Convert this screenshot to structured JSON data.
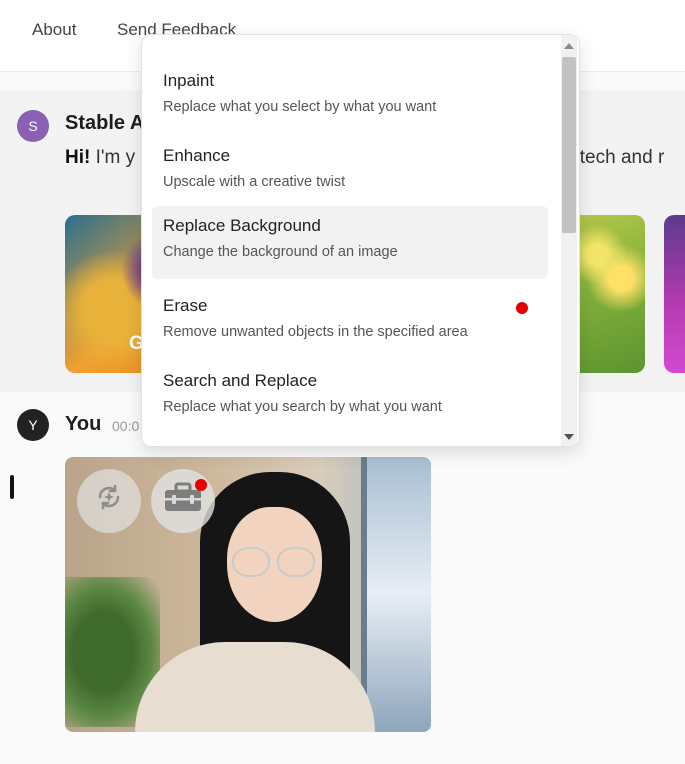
{
  "nav": {
    "about": "About",
    "feedback": "Send Feedback"
  },
  "ai_message": {
    "avatar_letter": "S",
    "sender": "Stable A",
    "greeting_bold": "Hi!",
    "text_start": " I'm y",
    "text_tail": "s tech and r",
    "card_label": "G"
  },
  "user_message": {
    "avatar_letter": "Y",
    "sender": "You",
    "time": "00:0"
  },
  "menu": {
    "items": [
      {
        "title": "Inpaint",
        "desc": "Replace what you select by what you want"
      },
      {
        "title": "Enhance",
        "desc": "Upscale with a creative twist"
      },
      {
        "title": "Replace Background",
        "desc": "Change the background of an image"
      },
      {
        "title": "Erase",
        "desc": "Remove unwanted objects in the specified area"
      },
      {
        "title": "Search and Replace",
        "desc": "Replace what you search by what you want"
      }
    ],
    "hovered_item": "Replace Background",
    "new_badge_item": "Erase"
  },
  "icons": {
    "regenerate": "refresh-sparkle-icon",
    "toolbox": "toolbox-icon"
  },
  "colors": {
    "ai_avatar": "#8b5fb3",
    "user_avatar": "#222222",
    "notification_dot": "#e60000"
  }
}
